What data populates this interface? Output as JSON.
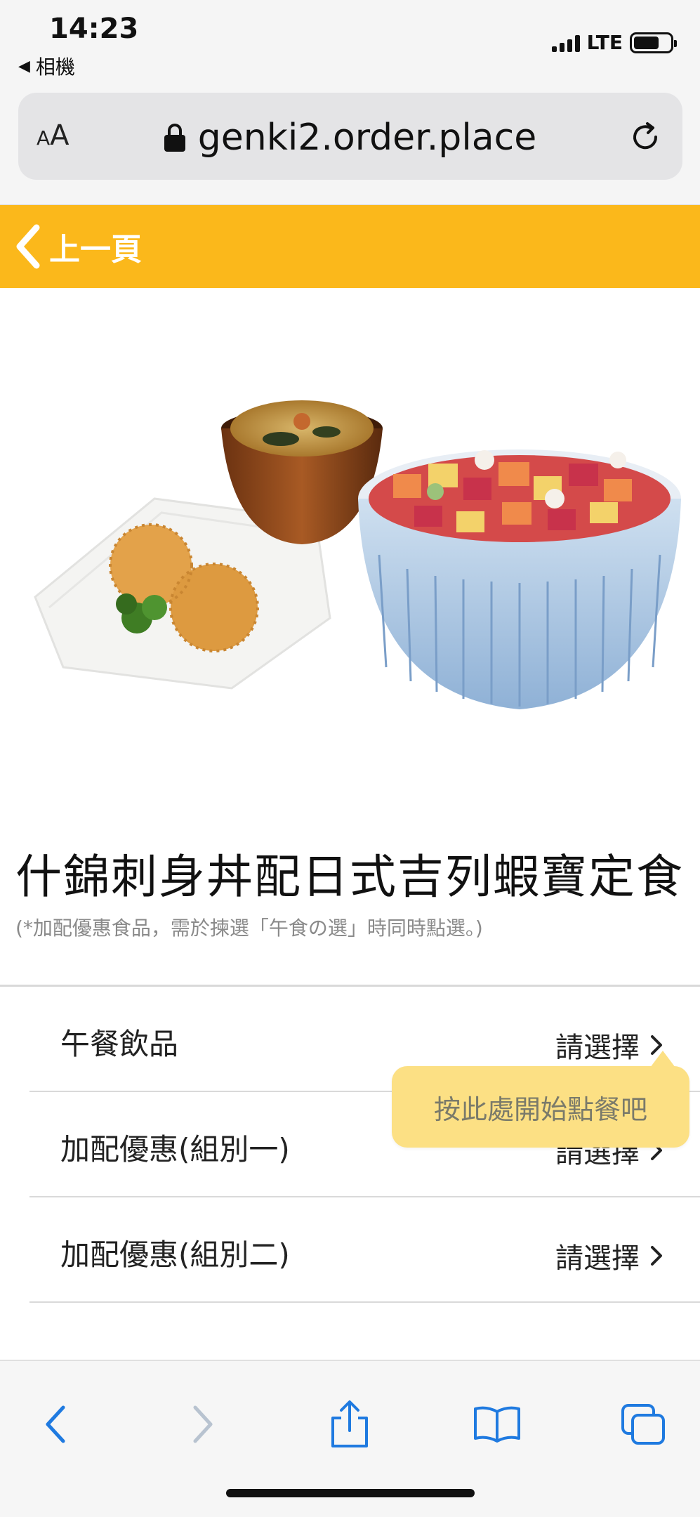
{
  "status_bar": {
    "time": "14:23",
    "back_app": "相機",
    "network": "LTE"
  },
  "browser": {
    "text_size_button": "AA",
    "url": "genki2.order.place"
  },
  "header": {
    "back_label": "上一頁",
    "color": "#fbb81b"
  },
  "product": {
    "title": "什錦刺身丼配日式吉列蝦寶定食",
    "note": "(*加配優惠食品，需於揀選「午食の選」時同時點選。)"
  },
  "options": [
    {
      "label": "午餐飲品",
      "action": "請選擇"
    },
    {
      "label": "加配優惠(組別一)",
      "action": "請選擇"
    },
    {
      "label": "加配優惠(組別二)",
      "action": "請選擇"
    }
  ],
  "tooltip": {
    "text": "按此處開始點餐吧",
    "color": "#fce084"
  },
  "toolbar": {
    "icons": [
      "back-arrow-icon",
      "forward-arrow-icon",
      "share-icon",
      "bookmarks-icon",
      "tabs-icon"
    ],
    "accent": "#1f7ae0"
  }
}
